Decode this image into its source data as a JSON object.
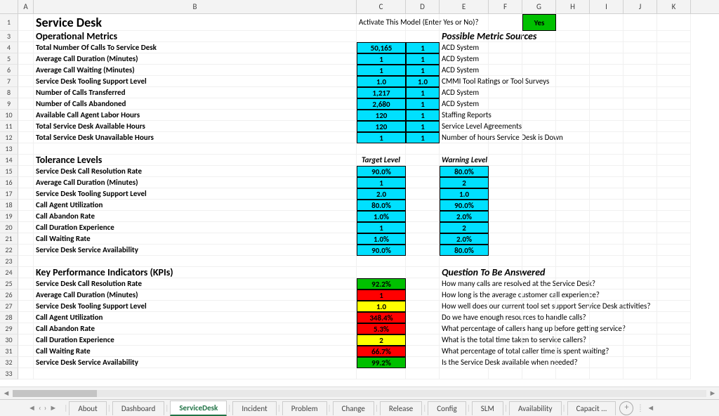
{
  "chart_data": {
    "type": "table",
    "note": "spreadsheet content; numeric values captured in sections below"
  },
  "columns": [
    "A",
    "B",
    "C",
    "D",
    "E",
    "F",
    "G",
    "H",
    "I",
    "J",
    "K"
  ],
  "title": "Service Desk",
  "activate": {
    "prompt": "Activate This Model (Enter Yes or No)?",
    "value": "Yes"
  },
  "sections": {
    "metrics_hdr": "Operational Metrics",
    "sources_hdr": "Possible Metric Sources",
    "tolerance_hdr": "Tolerance Levels",
    "target_hdr": "Target Level",
    "warning_hdr": "Warning Level",
    "kpi_hdr": "Key Performance Indicators (KPIs)",
    "question_hdr": "Question To Be Answered"
  },
  "metrics": [
    {
      "label": "Total Number Of Calls To Service Desk",
      "c": "50,165",
      "d": "1",
      "src": "ACD System"
    },
    {
      "label": "Average Call Duration (Minutes)",
      "c": "1",
      "d": "1",
      "src": "ACD System"
    },
    {
      "label": "Average Call Waiting (Minutes)",
      "c": "1",
      "d": "1",
      "src": "ACD System"
    },
    {
      "label": "Service Desk Tooling Support Level",
      "c": "1.0",
      "d": "1.0",
      "src": "CMMI Tool Ratings or Tool Surveys"
    },
    {
      "label": "Number of Calls Transferred",
      "c": "1,217",
      "d": "1",
      "src": "ACD System"
    },
    {
      "label": "Number of Calls Abandoned",
      "c": "2,680",
      "d": "1",
      "src": "ACD System"
    },
    {
      "label": "Available Call Agent Labor Hours",
      "c": "120",
      "d": "1",
      "src": "Staffing Reports"
    },
    {
      "label": "Total Service Desk Available Hours",
      "c": "120",
      "d": "1",
      "src": "Service Level Agreements"
    },
    {
      "label": "Total Service Desk Unavailable Hours",
      "c": "1",
      "d": "1",
      "src": "Number of hours Service Desk is Down"
    }
  ],
  "tolerance": [
    {
      "label": "Service Desk Call Resolution Rate",
      "c": "90.0%",
      "e": "80.0%"
    },
    {
      "label": "Average Call Duration (Minutes)",
      "c": "1",
      "e": "2"
    },
    {
      "label": "Service Desk Tooling Support Level",
      "c": "2.0",
      "e": "1.0"
    },
    {
      "label": "Call Agent Utilization",
      "c": "80.0%",
      "e": "90.0%"
    },
    {
      "label": "Call Abandon Rate",
      "c": "1.0%",
      "e": "2.0%"
    },
    {
      "label": "Call Duration Experience",
      "c": "1",
      "e": "2"
    },
    {
      "label": "Call Waiting Rate",
      "c": "1.0%",
      "e": "2.0%"
    },
    {
      "label": "Service Desk Service Availability",
      "c": "90.0%",
      "e": "80.0%"
    }
  ],
  "kpi": [
    {
      "label": "Service Desk Call Resolution Rate",
      "c": "92.2%",
      "cls": "green",
      "q": "How many calls are resolved at the Service Desk?"
    },
    {
      "label": "Average Call Duration (Minutes)",
      "c": "1",
      "cls": "red",
      "q": "How long is the average customer call experience?"
    },
    {
      "label": "Service Desk Tooling Support Level",
      "c": "1.0",
      "cls": "yellow",
      "q": "How well does our current tool set support Service Desk activities?"
    },
    {
      "label": "Call Agent Utilization",
      "c": "348.4%",
      "cls": "red",
      "q": "Do we have enough resources to handle calls?"
    },
    {
      "label": "Call Abandon Rate",
      "c": "5.3%",
      "cls": "red",
      "q": "What percentage of callers hang up before getting service?"
    },
    {
      "label": "Call Duration Experience",
      "c": "2",
      "cls": "yellow",
      "q": "What is the total time taken to service callers?"
    },
    {
      "label": "Call Waiting Rate",
      "c": "66.7%",
      "cls": "red",
      "q": "What percentage of total caller time is spent waiting?"
    },
    {
      "label": "Service Desk Service Availability",
      "c": "99.2%",
      "cls": "green",
      "q": "Is the Service Desk available when needed?"
    }
  ],
  "tabs": [
    "About",
    "Dashboard",
    "ServiceDesk",
    "Incident",
    "Problem",
    "Change",
    "Release",
    "Config",
    "SLM",
    "Availability",
    "Capacit ..."
  ],
  "active_tab": "ServiceDesk"
}
